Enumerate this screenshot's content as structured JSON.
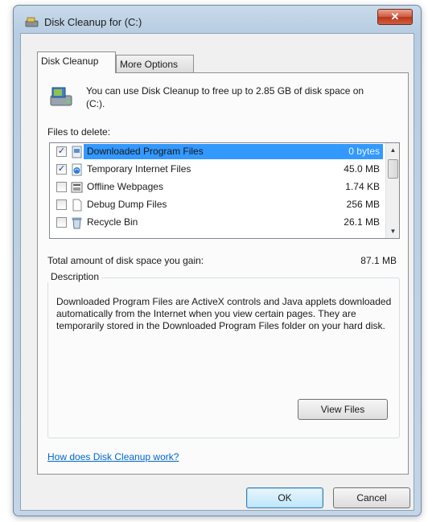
{
  "window": {
    "title": "Disk Cleanup for (C:)",
    "close_glyph": "✕"
  },
  "tabs": [
    {
      "label": "Disk Cleanup"
    },
    {
      "label": "More Options"
    }
  ],
  "info_text": "You can use Disk Cleanup to free up to 2.85 GB of disk space on (C:).",
  "files_label": "Files to delete:",
  "files": [
    {
      "checked": true,
      "icon": "program-files-icon",
      "name": "Downloaded Program Files",
      "size": "0 bytes",
      "selected": true
    },
    {
      "checked": true,
      "icon": "internet-files-icon",
      "name": "Temporary Internet Files",
      "size": "45.0 MB",
      "selected": false
    },
    {
      "checked": false,
      "icon": "offline-webpages-icon",
      "name": "Offline Webpages",
      "size": "1.74 KB",
      "selected": false
    },
    {
      "checked": false,
      "icon": "document-icon",
      "name": "Debug Dump Files",
      "size": "256 MB",
      "selected": false
    },
    {
      "checked": false,
      "icon": "recycle-bin-icon",
      "name": "Recycle Bin",
      "size": "26.1 MB",
      "selected": false
    }
  ],
  "check_glyph": "✓",
  "scroll": {
    "up": "▲",
    "down": "▼"
  },
  "total": {
    "label": "Total amount of disk space you gain:",
    "value": "87.1 MB"
  },
  "description": {
    "title": "Description",
    "text": "Downloaded Program Files are ActiveX controls and Java applets downloaded automatically from the Internet when you view certain pages. They are temporarily stored in the Downloaded Program Files folder on your hard disk.",
    "view_files_label": "View Files"
  },
  "help_link": "How does Disk Cleanup work?",
  "buttons": {
    "ok": "OK",
    "cancel": "Cancel"
  },
  "colors": {
    "selection": "#3399ff",
    "link": "#0066cc",
    "close": "#c9462a"
  }
}
